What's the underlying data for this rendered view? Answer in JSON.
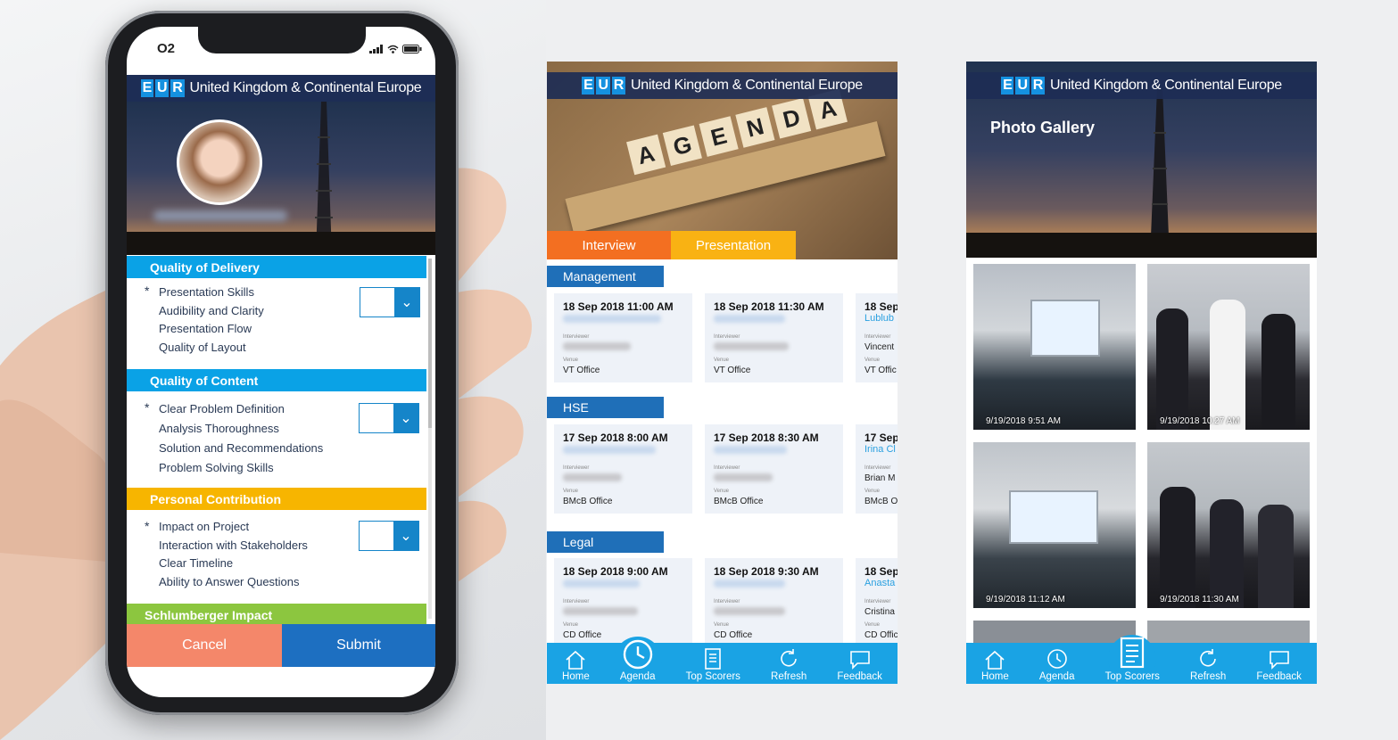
{
  "left_phone": {
    "carrier": "O2",
    "banner_eur": [
      "E",
      "U",
      "R"
    ],
    "banner_text": "United Kingdom & Continental Europe",
    "sections": [
      {
        "title": "Quality of Delivery",
        "color": "#0aa2e6",
        "criteria": [
          "Presentation Skills",
          "Audibility and Clarity",
          "Presentation Flow",
          "Quality of Layout"
        ]
      },
      {
        "title": "Quality of Content",
        "color": "#0aa2e6",
        "criteria": [
          "Clear Problem Definition",
          "Analysis Thoroughness",
          "Solution and Recommendations",
          "Problem Solving Skills"
        ]
      },
      {
        "title": "Personal Contribution",
        "color": "#f7b500",
        "criteria": [
          "Impact on Project",
          "Interaction with Stakeholders",
          "Clear Timeline",
          "Ability to Answer Questions"
        ]
      },
      {
        "title": "Schlumberger Impact",
        "color": "#8cc63f"
      }
    ],
    "required_mark": "*",
    "cancel_label": "Cancel",
    "submit_label": "Submit"
  },
  "middle_screen": {
    "banner_text": "United Kingdom & Continental Europe",
    "hero_letters": [
      "A",
      "G",
      "E",
      "N",
      "D",
      "A"
    ],
    "tabs": [
      {
        "label": "Interview",
        "color": "#f36f21"
      },
      {
        "label": "Presentation",
        "color": "#f9b213"
      }
    ],
    "categories": [
      {
        "name": "Management",
        "cards": [
          {
            "datetime": "18 Sep 2018 11:00 AM",
            "venue": "VT Office"
          },
          {
            "datetime": "18 Sep 2018 11:30 AM",
            "venue": "VT Office"
          },
          {
            "datetime": "18 Sep",
            "presenter": "Lublub",
            "interviewer": "Vincent",
            "venue": "VT Offic"
          }
        ]
      },
      {
        "name": "HSE",
        "cards": [
          {
            "datetime": "17 Sep 2018 8:00 AM",
            "venue": "BMcB Office"
          },
          {
            "datetime": "17 Sep 2018 8:30 AM",
            "venue": "BMcB Office"
          },
          {
            "datetime": "17 Sep",
            "presenter": "Irina Cl",
            "interviewer": "Brian M",
            "venue": "BMcB O"
          }
        ]
      },
      {
        "name": "Legal",
        "cards": [
          {
            "datetime": "18 Sep 2018 9:00 AM",
            "venue": "CD Office"
          },
          {
            "datetime": "18 Sep 2018 9:30 AM",
            "venue": "CD Office"
          },
          {
            "datetime": "18 Sep",
            "presenter": "Anasta",
            "interviewer": "Cristina",
            "venue": "CD Offic"
          }
        ]
      }
    ],
    "field_labels": {
      "interviewer": "Interviewer",
      "venue": "Venue"
    },
    "nav": [
      "Home",
      "Agenda",
      "Top Scorers",
      "Refresh",
      "Feedback"
    ]
  },
  "right_screen": {
    "banner_text": "United Kingdom & Continental Europe",
    "title": "Photo Gallery",
    "photos": [
      {
        "timestamp": "9/19/2018 9:51 AM",
        "kind": "room"
      },
      {
        "timestamp": "9/19/2018 10:27 AM",
        "kind": "people"
      },
      {
        "timestamp": "9/19/2018 11:12 AM",
        "kind": "room"
      },
      {
        "timestamp": "9/19/2018 11:30 AM",
        "kind": "people"
      }
    ],
    "nav": [
      "Home",
      "Agenda",
      "Top Scorers",
      "Refresh",
      "Feedback"
    ]
  },
  "colors": {
    "nav_blue": "#1aa3e4",
    "category_blue": "#1f6fb8",
    "cancel": "#f4876a",
    "submit": "#1d6fc1",
    "banner": "#1d2d55"
  }
}
